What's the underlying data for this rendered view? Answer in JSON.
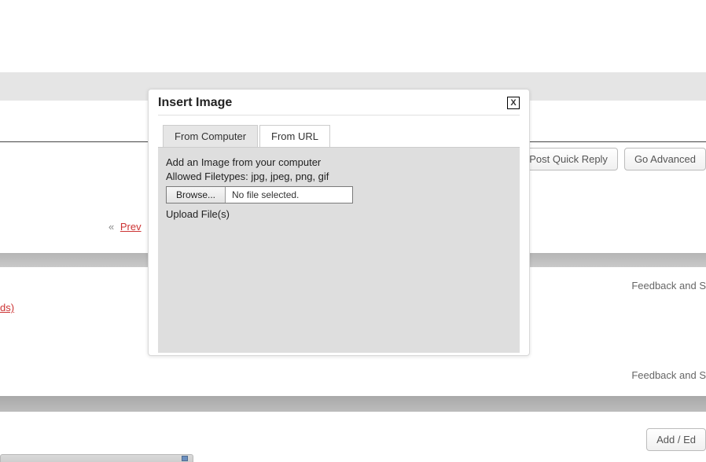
{
  "dialog": {
    "title": "Insert Image",
    "close_label": "X",
    "tabs": {
      "from_computer": "From Computer",
      "from_url": "From URL"
    },
    "body": {
      "instruction": "Add an Image from your computer",
      "allowed_types": "Allowed Filetypes: jpg, jpeg, png, gif",
      "browse_label": "Browse...",
      "file_status": "No file selected.",
      "upload_action": "Upload File(s)"
    }
  },
  "page": {
    "post_quick_reply": "Post Quick Reply",
    "go_advanced": "Go Advanced",
    "prev_chevron": "«",
    "prev_label": "Prev",
    "left_partial_link": "ds)",
    "feedback_text": "Feedback and S",
    "add_edit_label": "Add / Ed"
  }
}
